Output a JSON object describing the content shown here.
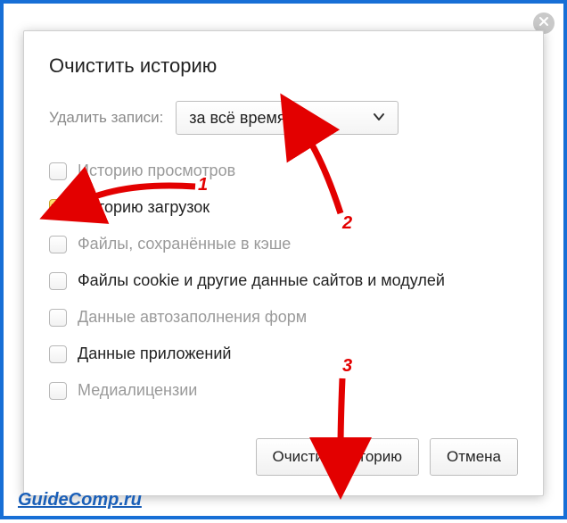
{
  "dialog": {
    "title": "Очистить историю",
    "delete_label": "Удалить записи:",
    "select_value": "за всё время"
  },
  "options": {
    "browsing": {
      "label": "Историю просмотров",
      "checked": false,
      "dim": true
    },
    "downloads": {
      "label": "Историю загрузок",
      "checked": true,
      "dim": false
    },
    "cache": {
      "label": "Файлы, сохранённые в кэше",
      "checked": false,
      "dim": true
    },
    "cookies": {
      "label": "Файлы cookie и другие данные сайтов и модулей",
      "checked": false,
      "dim": false
    },
    "autofill": {
      "label": "Данные автозаполнения форм",
      "checked": false,
      "dim": true
    },
    "appdata": {
      "label": "Данные приложений",
      "checked": false,
      "dim": false
    },
    "media": {
      "label": "Медиалицензии",
      "checked": false,
      "dim": true
    }
  },
  "footer": {
    "clear": "Очистить историю",
    "cancel": "Отмена"
  },
  "watermark": "GuideComp.ru",
  "annotations": {
    "n1": "1",
    "n2": "2",
    "n3": "3"
  }
}
